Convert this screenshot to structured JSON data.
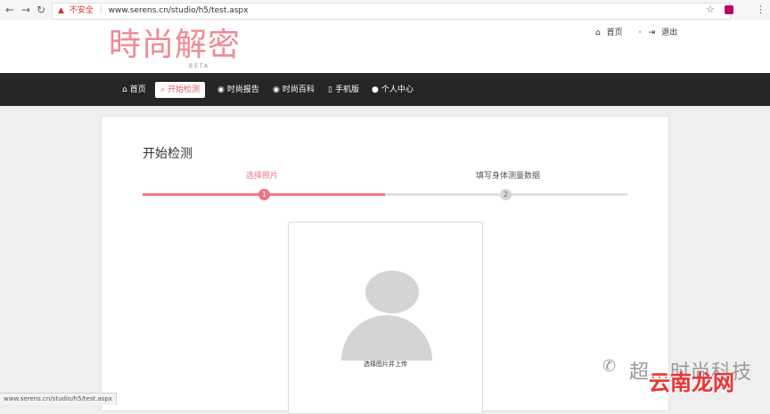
{
  "browser": {
    "back": "←",
    "forward": "→",
    "reload": "↻",
    "security_warning": "不安全",
    "url": "www.serens.cn/studio/h5/test.aspx",
    "star": "☆",
    "menu": "⋮"
  },
  "header": {
    "logo_text": "時尚解密",
    "logo_sub": "BETA",
    "links": [
      {
        "icon": "home-icon",
        "glyph": "⌂",
        "label": "首页"
      },
      {
        "icon": "logout-icon",
        "glyph": "⇥",
        "label": "退出"
      }
    ]
  },
  "nav": {
    "items": [
      {
        "glyph": "⌂",
        "label": "首页"
      },
      {
        "glyph": "⌕",
        "label": "开始检测"
      },
      {
        "glyph": "◉",
        "label": "时尚报告"
      },
      {
        "glyph": "◉",
        "label": "时尚百科"
      },
      {
        "glyph": "▯",
        "label": "手机版"
      },
      {
        "glyph": "●",
        "label": "个人中心"
      }
    ],
    "active_index": 1
  },
  "main": {
    "title": "开始检测",
    "steps": [
      {
        "number": "1",
        "label": "选择照片"
      },
      {
        "number": "2",
        "label": "填写身体测量数据"
      }
    ],
    "upload_label": "选择图片并上传"
  },
  "status_bar": "www.serens.cn/studio/h5/test.aspx",
  "watermark": {
    "text": "超…时尚科技",
    "overlay": "云南龙网"
  },
  "colors": {
    "accent": "#f0727e",
    "navbar": "#262626",
    "warning": "#d93025"
  }
}
